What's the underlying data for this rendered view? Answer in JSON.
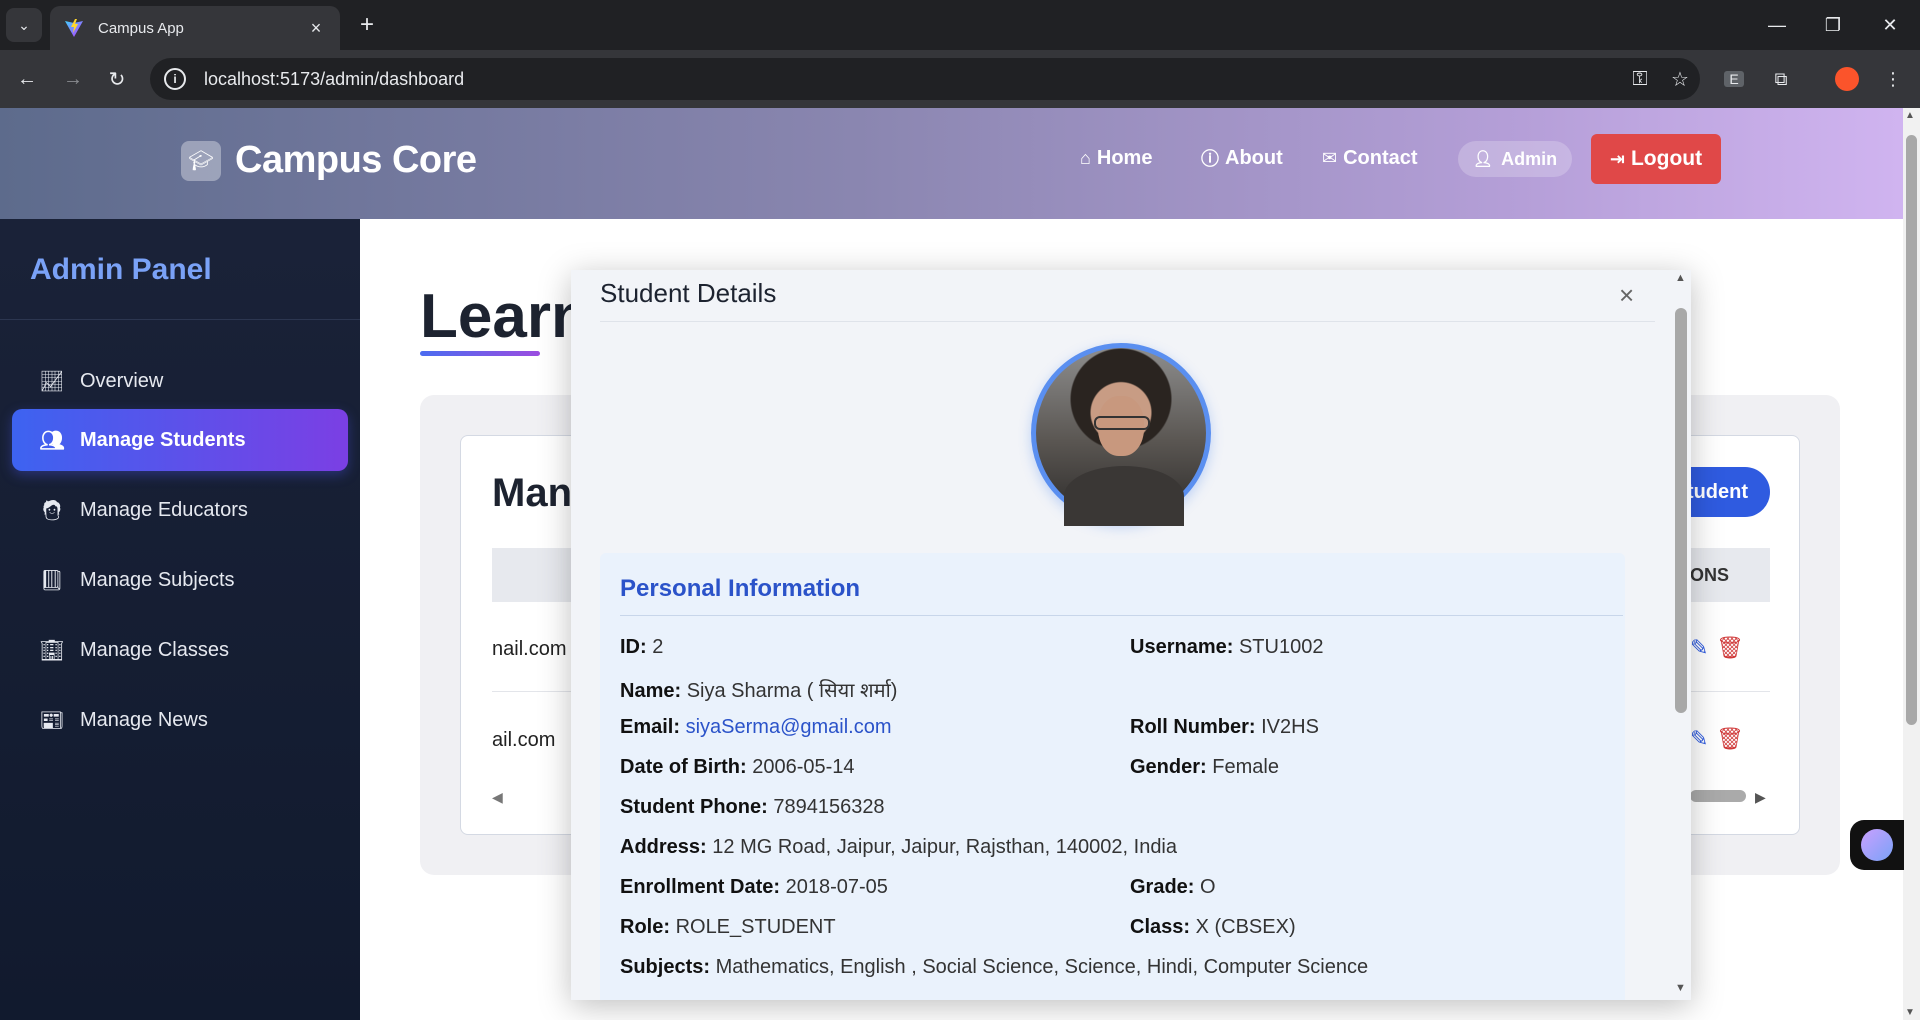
{
  "browser": {
    "tab_title": "Campus App",
    "url": "localhost:5173/admin/dashboard"
  },
  "header": {
    "brand": "Campus Core",
    "nav": [
      {
        "label": "Home",
        "icon": "home-icon"
      },
      {
        "label": "About",
        "icon": "info-icon"
      },
      {
        "label": "Contact",
        "icon": "mail-icon"
      }
    ],
    "admin_label": "Admin",
    "logout_label": "Logout"
  },
  "sidebar": {
    "title": "Admin Panel",
    "items": [
      {
        "label": "Overview",
        "icon": "chart-line-icon",
        "active": false
      },
      {
        "label": "Manage Students",
        "icon": "users-icon",
        "active": true
      },
      {
        "label": "Manage Educators",
        "icon": "chalkboard-teacher-icon",
        "active": false
      },
      {
        "label": "Manage Subjects",
        "icon": "book-icon",
        "active": false
      },
      {
        "label": "Manage Classes",
        "icon": "building-icon",
        "active": false
      },
      {
        "label": "Manage News",
        "icon": "newspaper-icon",
        "active": false
      }
    ]
  },
  "background": {
    "page_title": "Learn",
    "section_heading": "Man",
    "add_button": "tudent",
    "actions_header": "ONS",
    "rows": [
      "nail.com",
      "ail.com"
    ]
  },
  "modal": {
    "title": "Student Details",
    "close": "×",
    "section_heading": "Personal Information",
    "labels": {
      "id": "ID:",
      "username": "Username:",
      "name": "Name:",
      "email": "Email:",
      "roll": "Roll Number:",
      "dob": "Date of Birth:",
      "gender": "Gender:",
      "phone": "Student Phone:",
      "address": "Address:",
      "enrollment": "Enrollment Date:",
      "grade": "Grade:",
      "role": "Role:",
      "class": "Class:",
      "subjects": "Subjects:"
    },
    "values": {
      "id": "2",
      "username": "STU1002",
      "name": "Siya Sharma ( सिया शर्मा)",
      "email": "siyaSerma@gmail.com",
      "roll": "IV2HS",
      "dob": "2006-05-14",
      "gender": "Female",
      "phone": "7894156328",
      "address": "12 MG Road, Jaipur, Jaipur, Rajsthan, 140002, India",
      "enrollment": "2018-07-05",
      "grade": "O",
      "role": "ROLE_STUDENT",
      "class": "X (CBSEX)",
      "subjects": "Mathematics, English , Social Science, Science, Hindi, Computer Science"
    }
  },
  "colors": {
    "accent": "#2f5be0",
    "logout": "#e04848",
    "sidebar_bg": "#111a2e",
    "sidebar_title": "#7aa2f7",
    "info_heading": "#2b53c9"
  }
}
